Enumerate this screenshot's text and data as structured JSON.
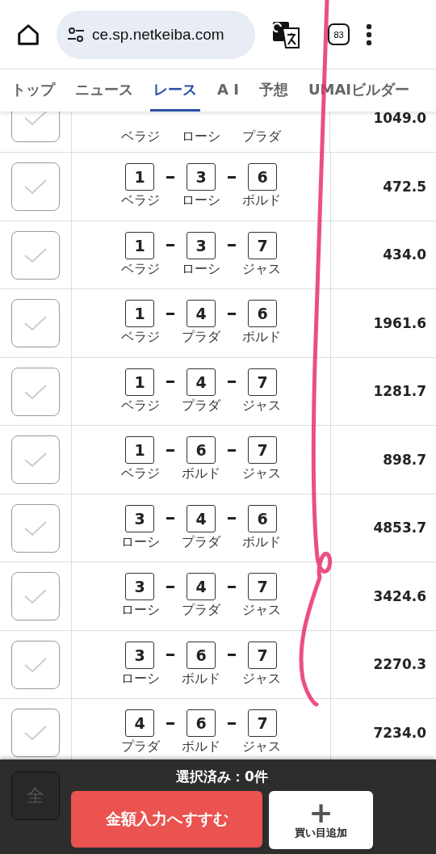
{
  "browser": {
    "url": "ce.sp.netkeiba.com",
    "tab_count": "83"
  },
  "tabs": [
    {
      "label": "トップ",
      "selected": false
    },
    {
      "label": "ニュース",
      "selected": false
    },
    {
      "label": "レース",
      "selected": true
    },
    {
      "label": "A I",
      "selected": false
    },
    {
      "label": "予想",
      "selected": false
    },
    {
      "label": "UMAIビルダー",
      "selected": false
    }
  ],
  "rows": [
    {
      "checked": false,
      "horses": [
        "ベラジ",
        "ローシ",
        "プラダ"
      ],
      "odds": "1049.0"
    },
    {
      "checked": false,
      "numbers": [
        "1",
        "3",
        "6"
      ],
      "horses": [
        "ベラジ",
        "ローシ",
        "ボルド"
      ],
      "odds": "472.5"
    },
    {
      "checked": false,
      "numbers": [
        "1",
        "3",
        "7"
      ],
      "horses": [
        "ベラジ",
        "ローシ",
        "ジャス"
      ],
      "odds": "434.0"
    },
    {
      "checked": false,
      "numbers": [
        "1",
        "4",
        "6"
      ],
      "horses": [
        "ベラジ",
        "プラダ",
        "ボルド"
      ],
      "odds": "1961.6"
    },
    {
      "checked": false,
      "numbers": [
        "1",
        "4",
        "7"
      ],
      "horses": [
        "ベラジ",
        "プラダ",
        "ジャス"
      ],
      "odds": "1281.7"
    },
    {
      "checked": false,
      "numbers": [
        "1",
        "6",
        "7"
      ],
      "horses": [
        "ベラジ",
        "ボルド",
        "ジャス"
      ],
      "odds": "898.7"
    },
    {
      "checked": false,
      "numbers": [
        "3",
        "4",
        "6"
      ],
      "horses": [
        "ローシ",
        "プラダ",
        "ボルド"
      ],
      "odds": "4853.7"
    },
    {
      "checked": false,
      "numbers": [
        "3",
        "4",
        "7"
      ],
      "horses": [
        "ローシ",
        "プラダ",
        "ジャス"
      ],
      "odds": "3424.6"
    },
    {
      "checked": false,
      "numbers": [
        "3",
        "6",
        "7"
      ],
      "horses": [
        "ローシ",
        "ボルド",
        "ジャス"
      ],
      "odds": "2270.3"
    },
    {
      "checked": false,
      "numbers": [
        "4",
        "6",
        "7"
      ],
      "horses": [
        "プラダ",
        "ボルド",
        "ジャス"
      ],
      "odds": "7234.0"
    }
  ],
  "footer": {
    "select_all": "全",
    "selected_count": "選択済み：0件",
    "proceed_button": "金額入力へすすむ",
    "add_button": "買い目追加",
    "add_icon": "+"
  }
}
